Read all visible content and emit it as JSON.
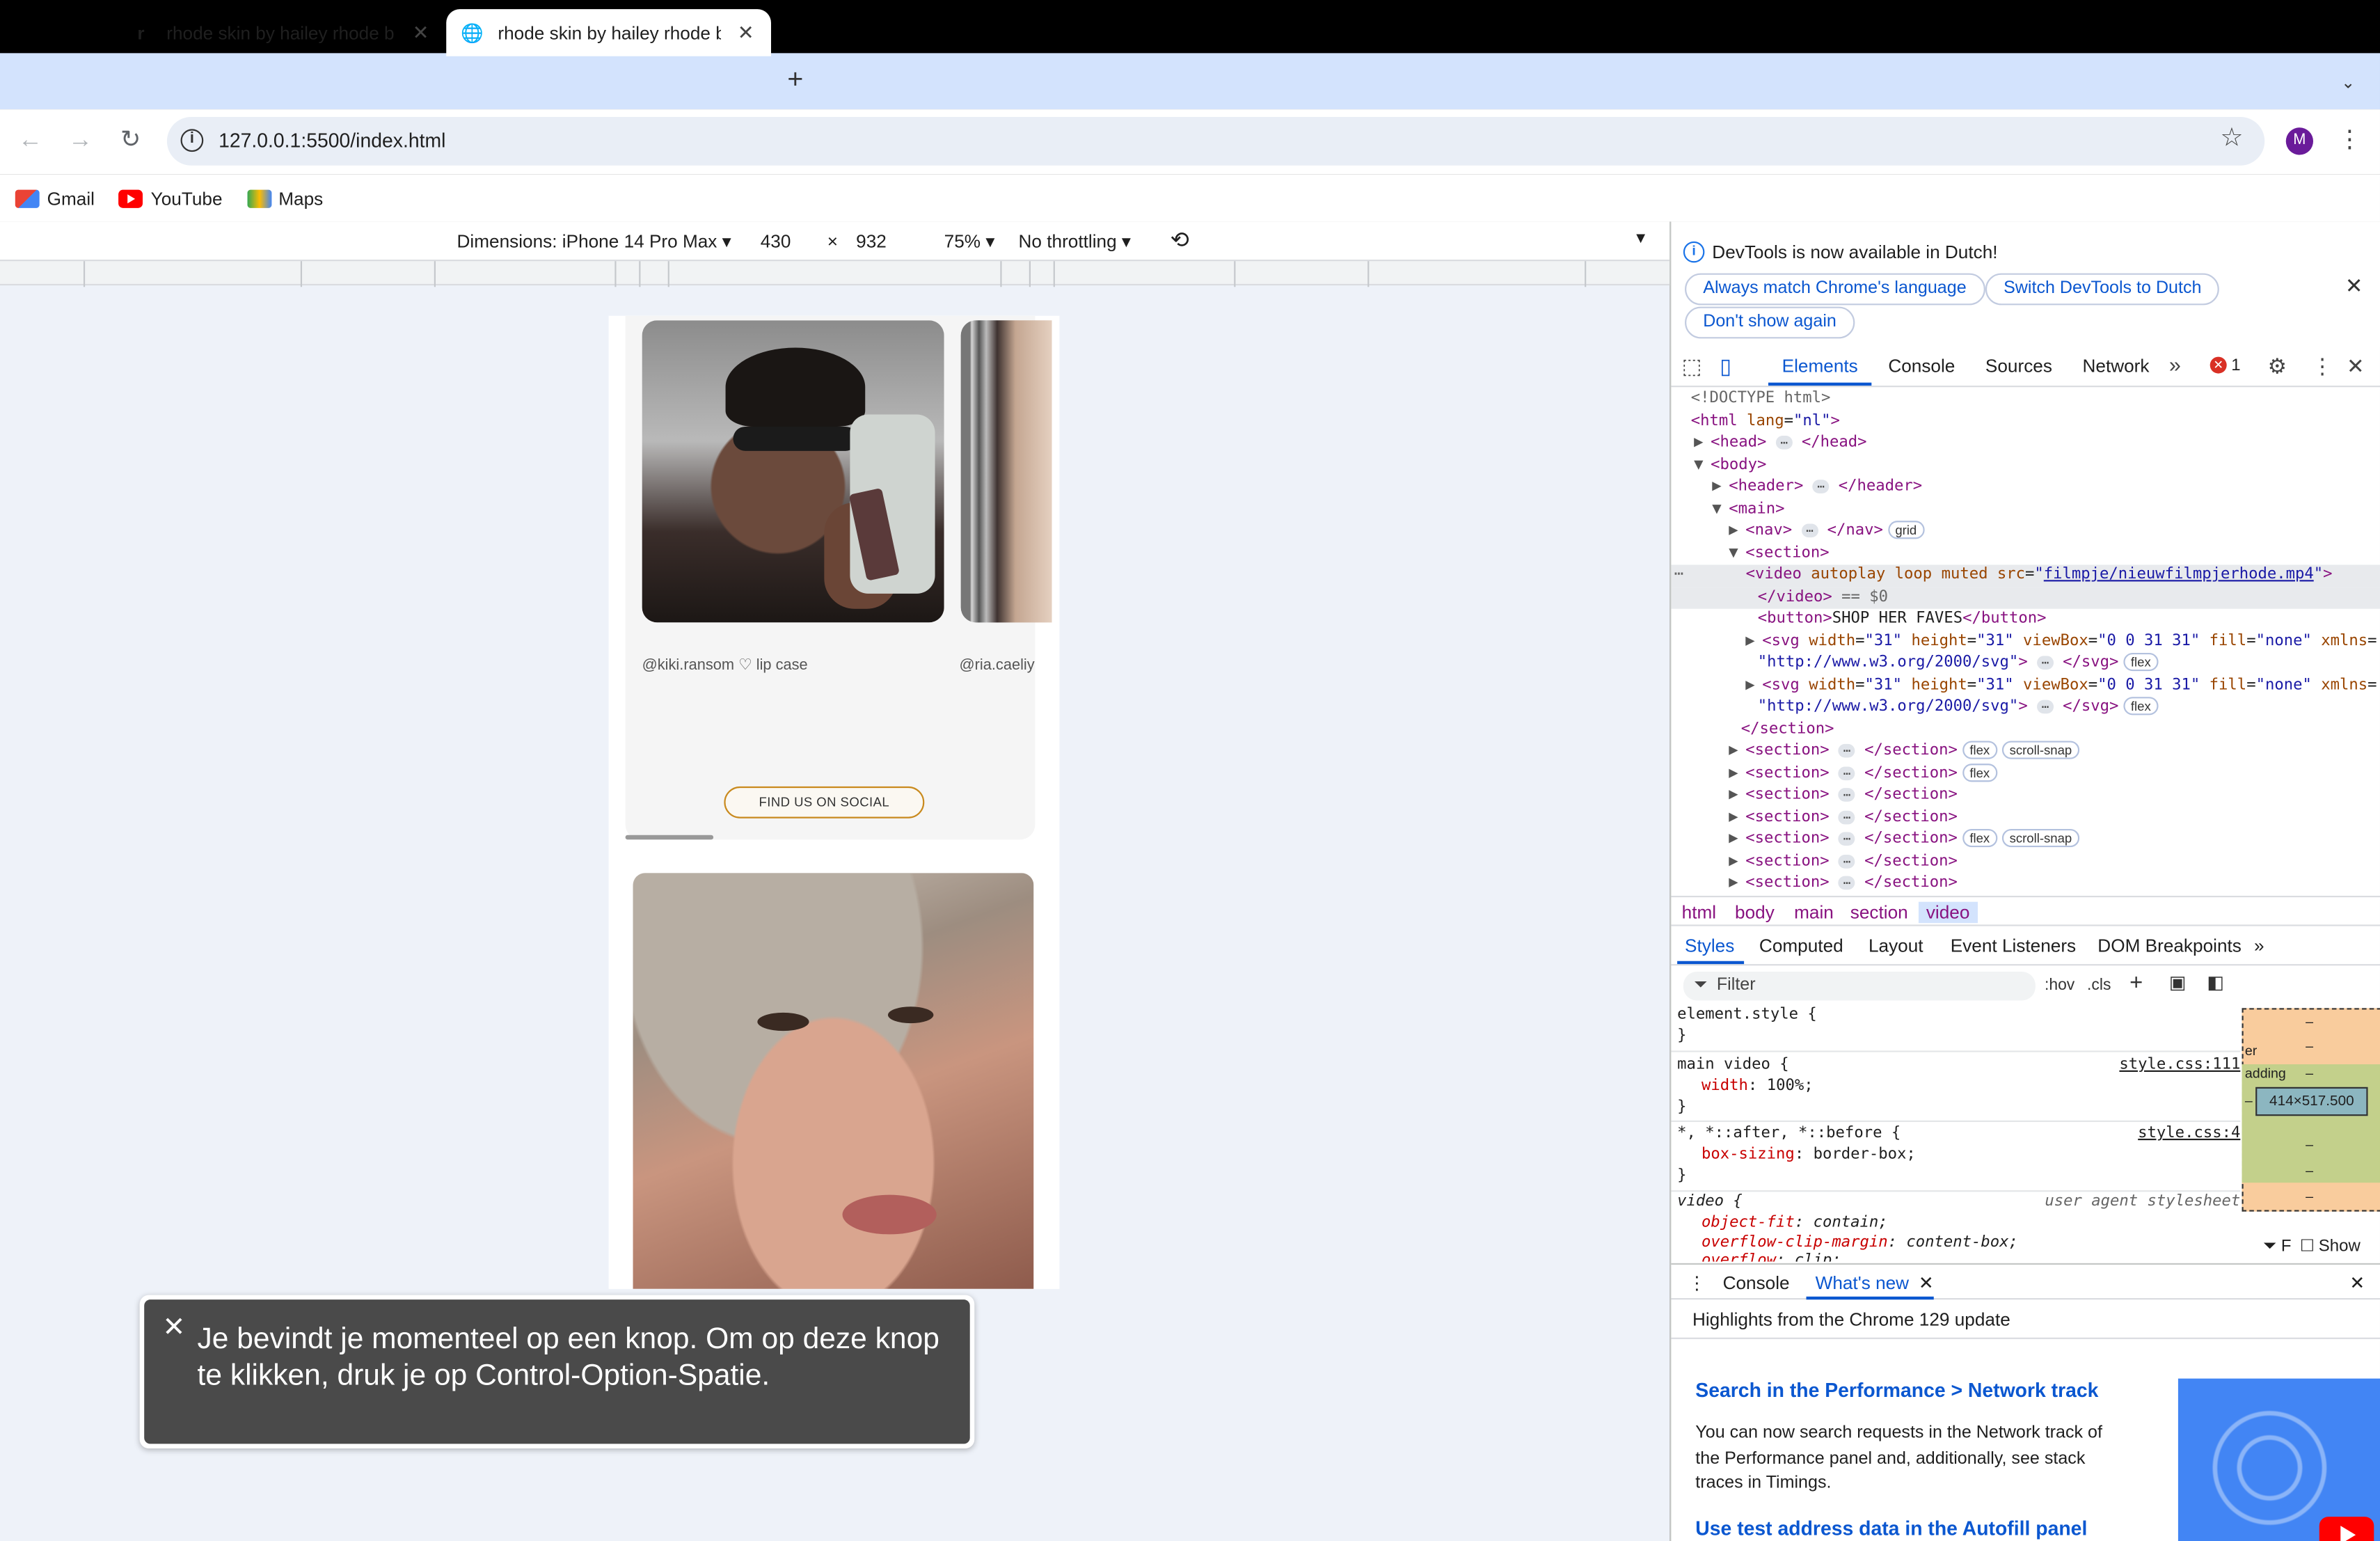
{
  "browser": {
    "tabs": [
      {
        "title": "rhode skin by hailey rhode bie",
        "favicon": "r"
      },
      {
        "title": "rhode skin by hailey rhode bie",
        "favicon": "globe-icon"
      }
    ],
    "url": "127.0.0.1:5500/index.html",
    "avatar_letter": "M",
    "bookmarks": [
      "Gmail",
      "YouTube",
      "Maps"
    ]
  },
  "device_toolbar": {
    "dimensions_label": "Dimensions: iPhone 14 Pro Max",
    "width": "430",
    "times": "×",
    "height": "932",
    "zoom": "75%",
    "throttling": "No throttling"
  },
  "page": {
    "caption_1": "@kiki.ransom ♡ lip case",
    "caption_2": "@ria.caeliy",
    "find_button": "FIND US ON SOCIAL"
  },
  "toast": {
    "text": "Je bevindt je momenteel op een knop. Om op deze knop te klikken, druk je op Control-Option-Spatie."
  },
  "devtools": {
    "banner": {
      "message": "DevTools is now available in Dutch!",
      "buttons": [
        "Always match Chrome's language",
        "Switch DevTools to Dutch",
        "Don't show again"
      ]
    },
    "tabs": [
      "Elements",
      "Console",
      "Sources",
      "Network"
    ],
    "error_count": "1",
    "dom": {
      "doctype": "<!DOCTYPE html>",
      "video_src": "filmpje/nieuwfilmpjerhode.mp4",
      "button_text": "SHOP HER FAVES",
      "svg_ns": "\"http://www.w3.org/2000/svg\"",
      "dollar_zero": "== $0"
    },
    "breadcrumbs": [
      "html",
      "body",
      "main",
      "section",
      "video"
    ],
    "styles_tabs": [
      "Styles",
      "Computed",
      "Layout",
      "Event Listeners",
      "DOM Breakpoints"
    ],
    "filter_placeholder": "Filter",
    "filter_tools": [
      ":hov",
      ".cls"
    ],
    "rules": {
      "r1_selector": "element.style {",
      "r2_selector": "main video {",
      "r2_source": "style.css:111",
      "r2_prop": "width",
      "r2_val": "100%;",
      "r3_selector": "*, *::after, *::before {",
      "r3_source": "style.css:4",
      "r3_prop": "box-sizing",
      "r3_val": "border-box;",
      "r4_selector": "video {",
      "r4_source": "user agent stylesheet",
      "r4_prop1": "object-fit",
      "r4_val1": "contain;",
      "r4_prop2": "overflow-clip-margin",
      "r4_val2": "content-box;",
      "r4_prop3": "overflow",
      "r4_val3": "clip;"
    },
    "box_model": {
      "content_size": "414×517.500",
      "margin_label": "er",
      "padding_label": "adding",
      "dash": "–",
      "show": "Show"
    },
    "drawer": {
      "tabs": [
        "Console",
        "What's new"
      ],
      "highlights": "Highlights from the Chrome 129 update",
      "heading_1": "Search in the Performance > Network track",
      "paragraph_1": "You can now search requests in the Network track of the Performance panel and, additionally, see stack traces in Timings.",
      "heading_2": "Use test address data in the Autofill panel"
    }
  }
}
